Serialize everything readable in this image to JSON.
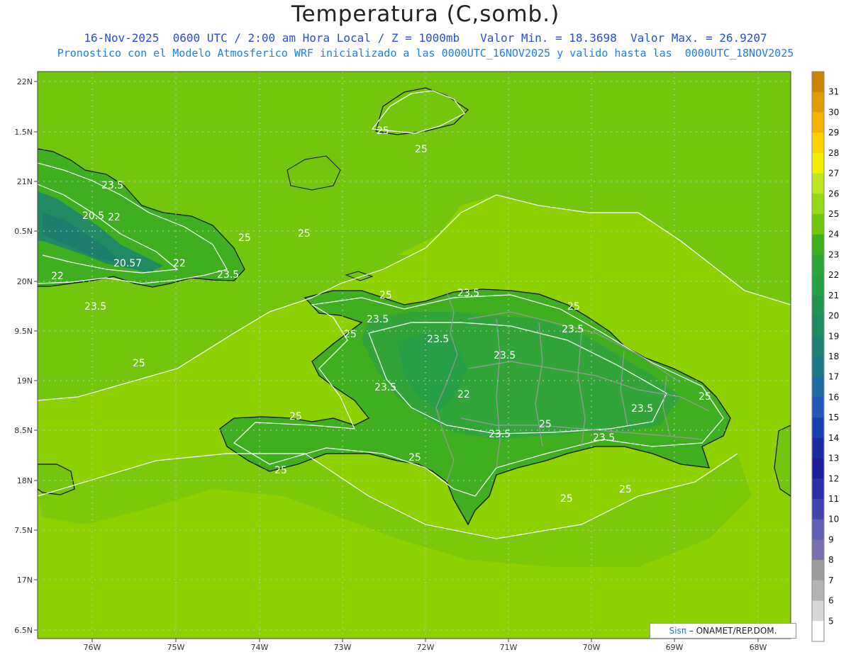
{
  "header": {
    "title": "Temperatura (C,somb.)",
    "subtitle_line1": "16-Nov-2025  0600 UTC / 2:00 am Hora Local / Z = 1000mb   Valor Min. = 18.3698  Valor Max. = 26.9207",
    "subtitle_line2": "Pronostico con el Modelo Atmosferico WRF inicializado a las 0000UTC_16NOV2025 y valido hasta las  0000UTC_18NOV2025"
  },
  "map": {
    "lat_labels": [
      "22N",
      "1.5N",
      "21N",
      "0.5N",
      "20N",
      "9.5N",
      "19N",
      "8.5N",
      "18N",
      "7.5N",
      "17N",
      "6.5N"
    ],
    "lon_labels": [
      "76W",
      "75W",
      "74W",
      "73W",
      "72W",
      "71W",
      "70W",
      "69W",
      "68W"
    ],
    "contour_labels": [
      {
        "text": "25"
      },
      {
        "text": "25"
      },
      {
        "text": "23.5"
      },
      {
        "text": "20.5"
      },
      {
        "text": "22"
      },
      {
        "text": "25"
      },
      {
        "text": "25"
      },
      {
        "text": "20.57"
      },
      {
        "text": "22"
      },
      {
        "text": "23.5"
      },
      {
        "text": "22"
      },
      {
        "text": "23.5"
      },
      {
        "text": "25"
      },
      {
        "text": "23.5"
      },
      {
        "text": "25"
      },
      {
        "text": "23.5"
      },
      {
        "text": "25"
      },
      {
        "text": "23.5"
      },
      {
        "text": "23.5"
      },
      {
        "text": "23.5"
      },
      {
        "text": "25"
      },
      {
        "text": "22"
      },
      {
        "text": "23.5"
      },
      {
        "text": "25"
      },
      {
        "text": "25"
      },
      {
        "text": "23.5"
      },
      {
        "text": "23.5"
      },
      {
        "text": "25"
      },
      {
        "text": "23.5"
      },
      {
        "text": "25"
      },
      {
        "text": "25"
      },
      {
        "text": "25"
      },
      {
        "text": "25"
      }
    ]
  },
  "colorbar": {
    "levels": [
      "31",
      "30",
      "29",
      "28",
      "27",
      "26",
      "25",
      "24",
      "23",
      "22",
      "21",
      "20",
      "19",
      "18",
      "17",
      "16",
      "15",
      "14",
      "13",
      "12",
      "11",
      "10",
      "9",
      "8",
      "7",
      "6",
      "5"
    ],
    "colors": [
      "#c98400",
      "#e19d00",
      "#f5b400",
      "#ffd200",
      "#f0f000",
      "#bfe51f",
      "#97d818",
      "#72c60d",
      "#3fae1f",
      "#31a53a",
      "#28a046",
      "#249352",
      "#218a62",
      "#1f8272",
      "#1d7784",
      "#1f6aa2",
      "#2258b8",
      "#1c3fb0",
      "#1a2ba0",
      "#1c1c9c",
      "#2e2ea8",
      "#4444b0",
      "#6060b4",
      "#7a70b0",
      "#9c9c9c",
      "#b4b4b4",
      "#d8d8d8",
      "#ffffff"
    ]
  },
  "credit": {
    "sis": "Sisπ",
    "text": " – ONAMET/REP.DOM."
  }
}
